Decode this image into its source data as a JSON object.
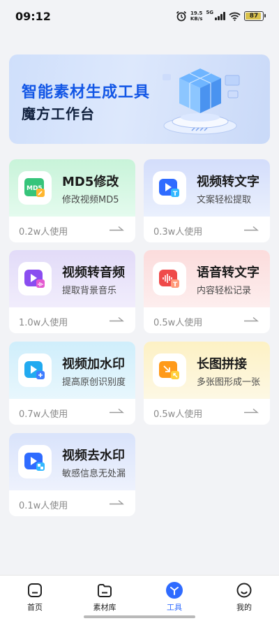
{
  "status_bar": {
    "time": "09:12",
    "net_speed_value": "19.5",
    "net_speed_unit": "KB/s",
    "network": "5G",
    "battery": "87"
  },
  "banner": {
    "title": "智能素材生成工具",
    "subtitle": "魔方工作台"
  },
  "tools": [
    {
      "title": "MD5修改",
      "subtitle": "修改视频MD5",
      "usage": "0.2w人使用",
      "color": "#c8f3d9",
      "icon": "md5-edit-icon"
    },
    {
      "title": "视频转文字",
      "subtitle": "文案轻松提取",
      "usage": "0.3w人使用",
      "color": "#d3ddfb",
      "icon": "video-to-text-icon"
    },
    {
      "title": "视频转音频",
      "subtitle": "提取背景音乐",
      "usage": "1.0w人使用",
      "color": "#e2dbf8",
      "icon": "video-to-audio-icon"
    },
    {
      "title": "语音转文字",
      "subtitle": "内容轻松记录",
      "usage": "0.5w人使用",
      "color": "#fcdcdc",
      "icon": "voice-to-text-icon"
    },
    {
      "title": "视频加水印",
      "subtitle": "提高原创识别度",
      "usage": "0.7w人使用",
      "color": "#cfeefb",
      "icon": "video-watermark-add-icon"
    },
    {
      "title": "长图拼接",
      "subtitle": "多张图形成一张",
      "usage": "0.5w人使用",
      "color": "#fdf1c4",
      "icon": "long-image-stitch-icon"
    },
    {
      "title": "视频去水印",
      "subtitle": "敏感信息无处漏",
      "usage": "0.1w人使用",
      "color": "#d9e3fb",
      "icon": "video-watermark-remove-icon"
    }
  ],
  "nav": [
    {
      "label": "首页",
      "icon": "home-icon"
    },
    {
      "label": "素材库",
      "icon": "folder-icon"
    },
    {
      "label": "工具",
      "icon": "tools-icon",
      "active": true
    },
    {
      "label": "我的",
      "icon": "profile-icon"
    }
  ],
  "colors": {
    "accent": "#2f6bff",
    "background": "#f2f3f6"
  }
}
